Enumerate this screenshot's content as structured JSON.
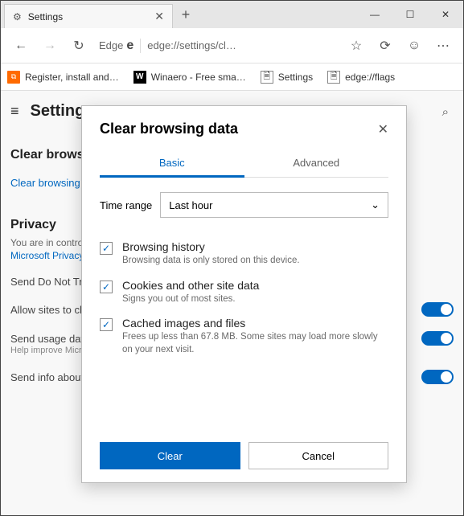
{
  "window": {
    "tab_title": "Settings"
  },
  "toolbar": {
    "address_prefix": "Edge",
    "url": "edge://settings/cl…"
  },
  "bookmarks": [
    {
      "label": "Register, install and…"
    },
    {
      "label": "Winaero - Free sma…"
    },
    {
      "label": "Settings"
    },
    {
      "label": "edge://flags"
    }
  ],
  "page": {
    "title": "Settings",
    "section_clear": "Clear browsing data",
    "clear_link": "Clear browsing data",
    "section_privacy": "Privacy",
    "privacy_blurb_1": "You are in control of your data. Learn more about the Microsoft products.",
    "privacy_blurb_link": "Microsoft Privacy Statement",
    "row_send": "Send Do Not Track requests",
    "row_allow": "Allow sites to check if you have payment methods saved",
    "row_send2": "Send usage data",
    "row_help": "Help improve Microsoft products",
    "row_send3": "Send info about websites you visit to Microsoft"
  },
  "dialog": {
    "title": "Clear browsing data",
    "tab_basic": "Basic",
    "tab_advanced": "Advanced",
    "time_label": "Time range",
    "time_value": "Last hour",
    "items": [
      {
        "label": "Browsing history",
        "desc": "Browsing data is only stored on this device."
      },
      {
        "label": "Cookies and other site data",
        "desc": "Signs you out of most sites."
      },
      {
        "label": "Cached images and files",
        "desc": "Frees up less than 67.8 MB. Some sites may load more slowly on your next visit."
      }
    ],
    "btn_clear": "Clear",
    "btn_cancel": "Cancel"
  }
}
